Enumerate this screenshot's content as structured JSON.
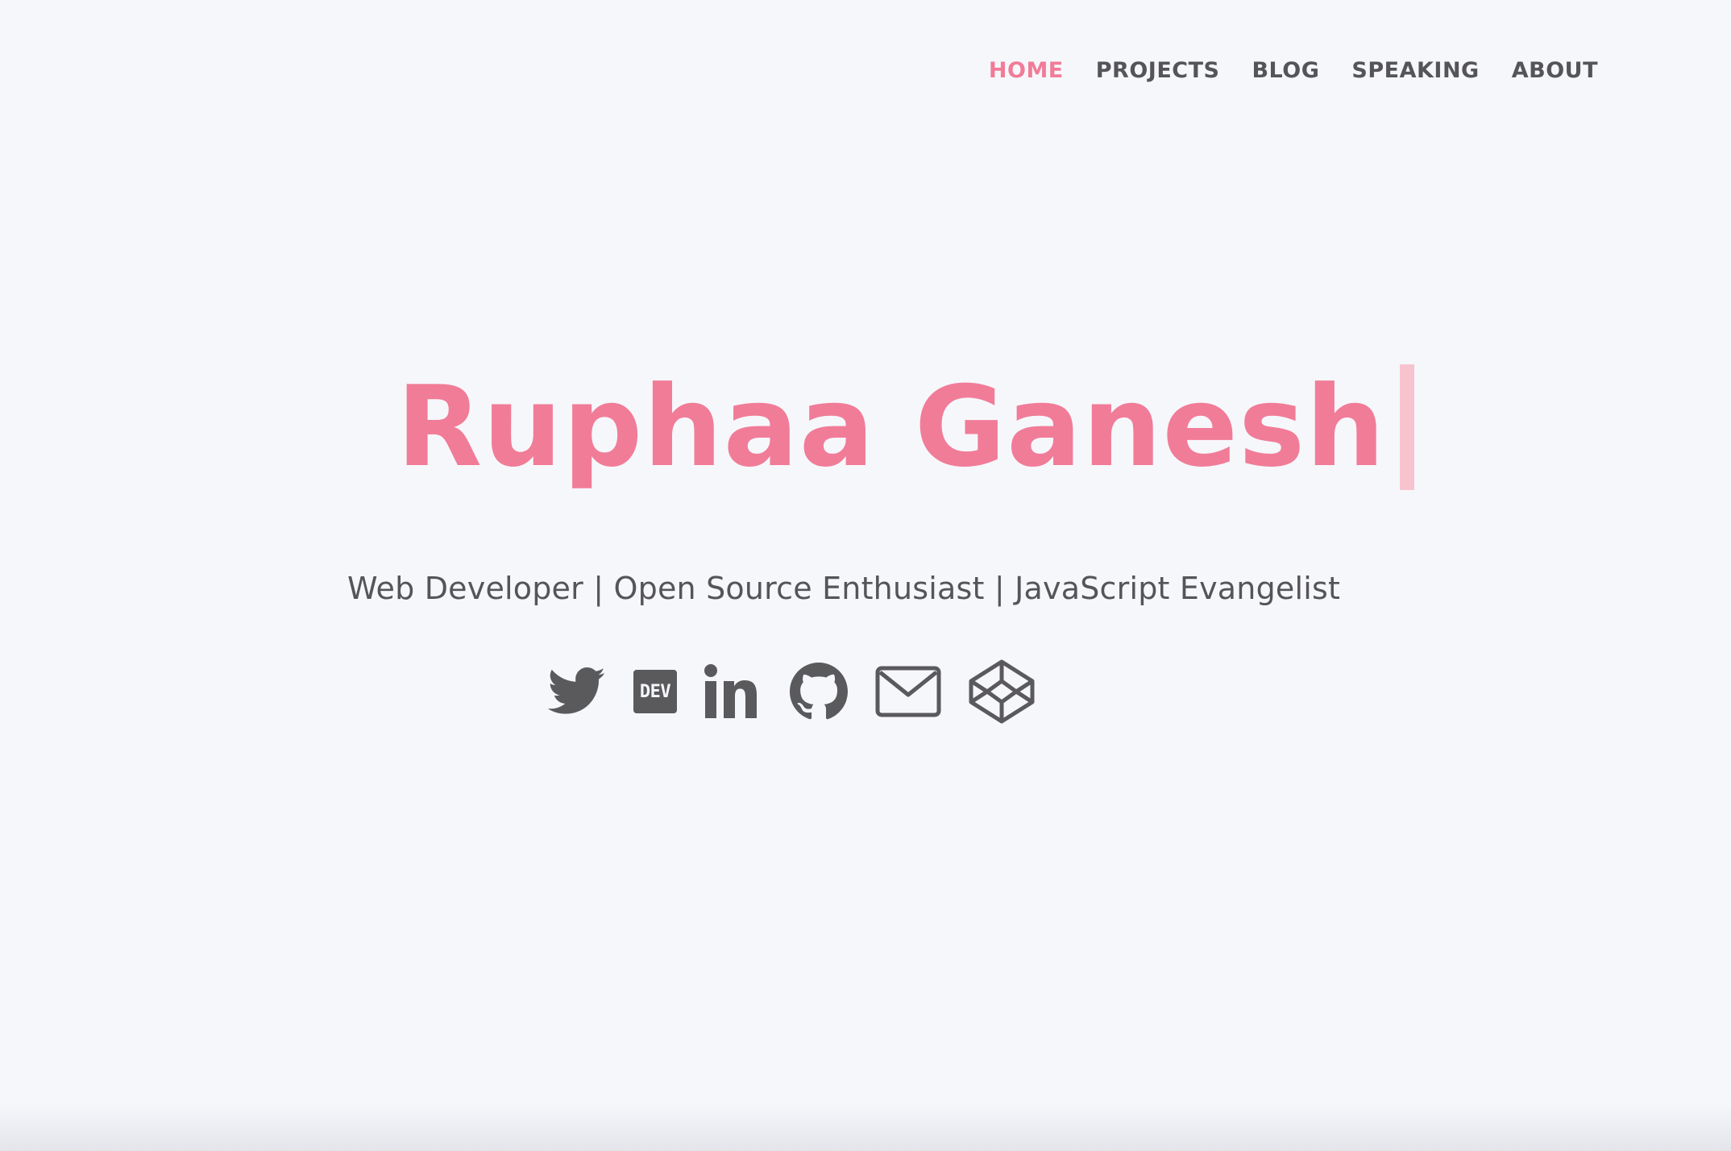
{
  "nav": {
    "items": [
      {
        "label": "HOME",
        "active": true
      },
      {
        "label": "PROJECTS",
        "active": false
      },
      {
        "label": "BLOG",
        "active": false
      },
      {
        "label": "SPEAKING",
        "active": false
      },
      {
        "label": "ABOUT",
        "active": false
      }
    ]
  },
  "hero": {
    "name": "Ruphaa Ganesh",
    "tagline": "Web Developer | Open Source Enthusiast | JavaScript Evangelist"
  },
  "social": {
    "dev_label": "DEV",
    "icons": [
      "twitter-icon",
      "dev-icon",
      "linkedin-icon",
      "github-icon",
      "mail-icon",
      "codepen-icon"
    ]
  },
  "colors": {
    "accent": "#f17c98",
    "caret": "#f7c3cf",
    "text": "#555558",
    "background": "#f6f7fb"
  }
}
